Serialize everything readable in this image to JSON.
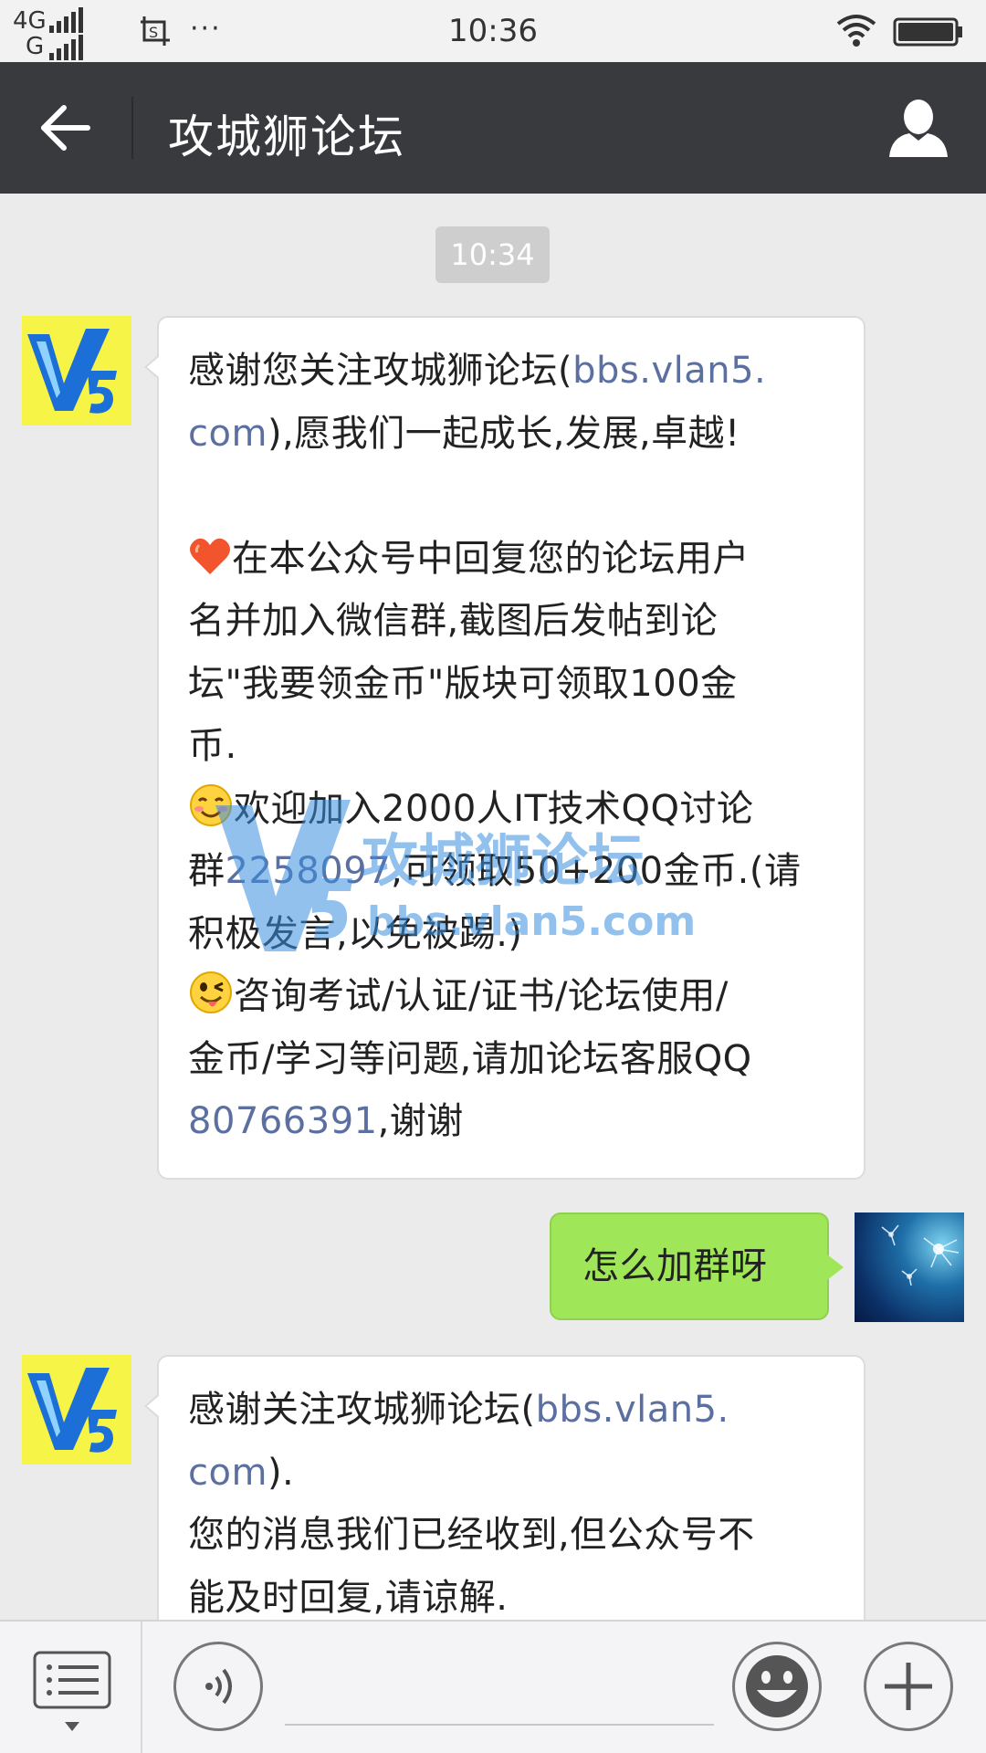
{
  "status_bar": {
    "network_top": "4G",
    "network_bottom": "G",
    "time": "10:36",
    "more_icon": "···"
  },
  "header": {
    "title": "攻城狮论坛",
    "back_icon": "arrow-left-icon",
    "profile_icon": "person-icon",
    "background": "#393a3e"
  },
  "chat": {
    "timestamp": "10:34",
    "messages": [
      {
        "from": "official",
        "lines": [
          [
            "感谢您关注攻城狮论坛(",
            "bbs.vlan5."
          ],
          [
            "com",
            "),愿我们一起成长,发展,卓越!"
          ],
          [],
          [
            "在本公众号中回复您的论坛用户"
          ],
          [
            "名并加入微信群,截图后发帖到论"
          ],
          [
            "坛\"我要领金币\"版块可领取100金"
          ],
          [
            "币."
          ],
          [
            "欢迎加入2000人IT技术QQ讨论"
          ],
          [
            "群",
            "2258097",
            ",可领取50+200金币.(请"
          ],
          [
            "积极发言,以免被踢.)"
          ],
          [
            "咨询考试/认证/证书/论坛使用/"
          ],
          [
            "金币/学习等问题,请加论坛客服QQ"
          ],
          [
            "80766391",
            ",谢谢"
          ]
        ]
      },
      {
        "from": "me",
        "text": "怎么加群呀"
      },
      {
        "from": "official",
        "lines": [
          [
            "感谢关注攻城狮论坛(",
            "bbs.vlan5."
          ],
          [
            "com",
            ")."
          ],
          [
            "您的消息我们已经收到,但公众号不"
          ],
          [
            "能及时回复,请谅解."
          ]
        ]
      }
    ],
    "watermark_text": "攻城狮论坛",
    "watermark_url": "bbs.vlan5.com",
    "avatar_logo": "V5"
  },
  "input_bar": {
    "placeholder": "",
    "menu_icon": "menu-list-icon",
    "voice_icon": "voice-icon",
    "emoji_icon": "smiley-icon",
    "plus_icon": "plus-icon"
  },
  "colors": {
    "link": "#5b6fa1",
    "outgoing_bubble": "#9fe658",
    "chat_background": "#ebebeb"
  }
}
